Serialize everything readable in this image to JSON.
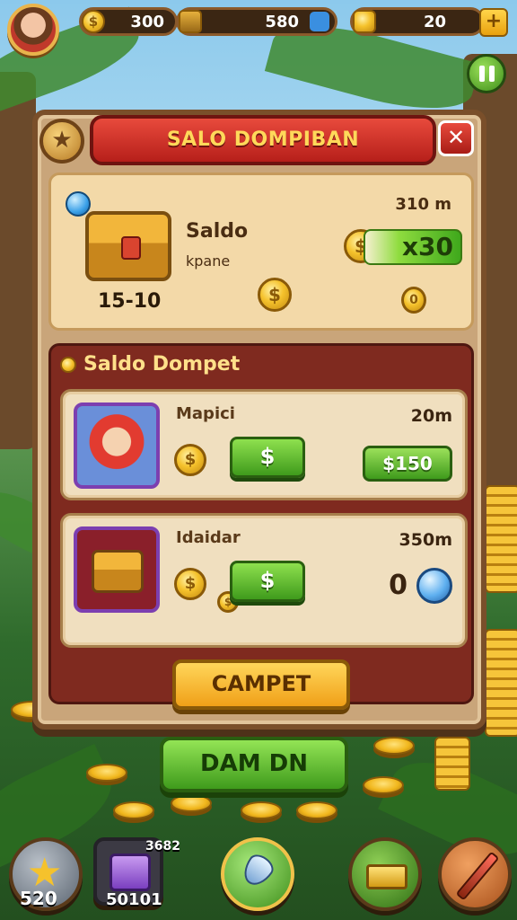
{
  "hud": {
    "coins": "300",
    "energy": "580",
    "gold": "20",
    "plus": "+"
  },
  "dialog": {
    "title": "SALO DOMPIBAN",
    "close": "✕",
    "summary": {
      "timer": "310 m",
      "label": "Saldo",
      "sublabel": "kpane",
      "count": "15-10",
      "multiplier": "x30"
    },
    "section_title": "Saldo Dompet",
    "rows": [
      {
        "name": "Mapici",
        "time": "20m",
        "button": "$",
        "price": "$150"
      },
      {
        "name": "Idaidar",
        "time": "350m",
        "button": "$",
        "amount": "0"
      }
    ],
    "confirm_button": "CAMPET"
  },
  "main_button": "DAM DN",
  "bottom_bar": {
    "star_count": "520",
    "cube_top": "3682",
    "cube_count": "50101"
  },
  "colors": {
    "title_red": "#b61f1a",
    "accent_green": "#3f9b1c",
    "gold": "#f5c22c",
    "panel_wood": "#7a4f2a"
  },
  "icons": [
    "coin-icon",
    "gem-icon",
    "pause-icon",
    "close-icon",
    "star-icon",
    "chest-icon",
    "orb-icon",
    "cube-icon",
    "sword-icon",
    "shovel-icon"
  ]
}
